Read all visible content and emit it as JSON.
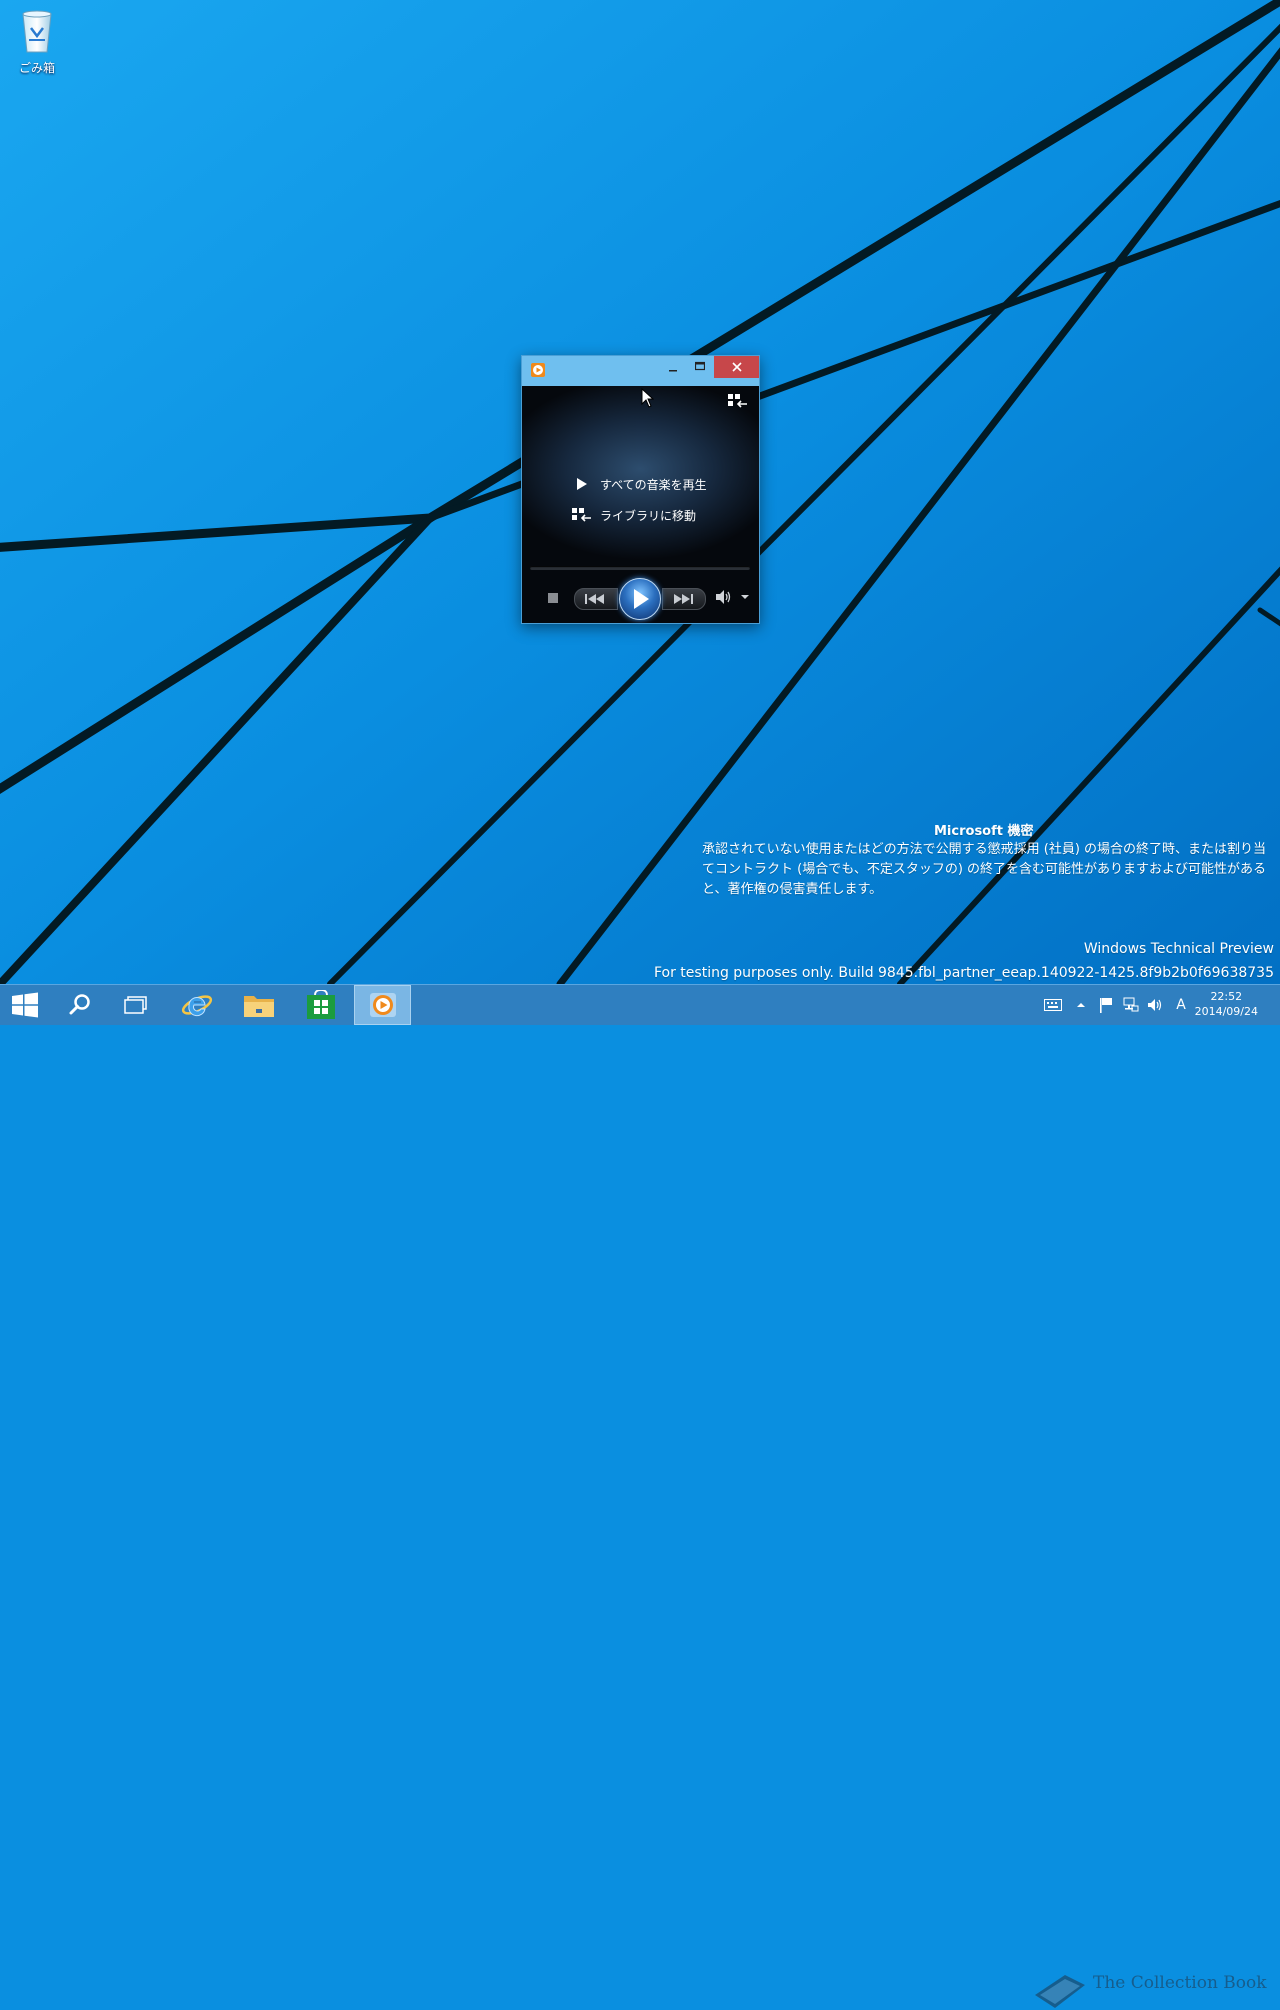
{
  "desktop": {
    "recycle_bin_label": "ごみ箱"
  },
  "wmp_window": {
    "menu": {
      "play_all": "すべての音楽を再生",
      "goto_library": "ライブラリに移動"
    }
  },
  "watermark": {
    "title": "Microsoft 機密",
    "body": "承認されていない使用またはどの方法で公開する懲戒採用 (社員) の場合の終了時、または割り当てコントラクト (場合でも、不定スタッフの) の終了を含む可能性がありますおよび可能性があると、著作権の侵害責任します。",
    "edition": "Windows Technical Preview",
    "build": "For testing purposes only. Build 9845.fbl_partner_eeap.140922-1425.8f9b2b0f69638735"
  },
  "taskbar": {
    "tray_ime": "A",
    "clock_time": "22:52",
    "clock_date": "2014/09/24",
    "site_watermark": "The Collection Book"
  },
  "colors": {
    "desktop": "#0a8fe0",
    "titlebar": "#6fbfef",
    "close": "#c7474a",
    "taskbar": "#2f7fc0"
  }
}
